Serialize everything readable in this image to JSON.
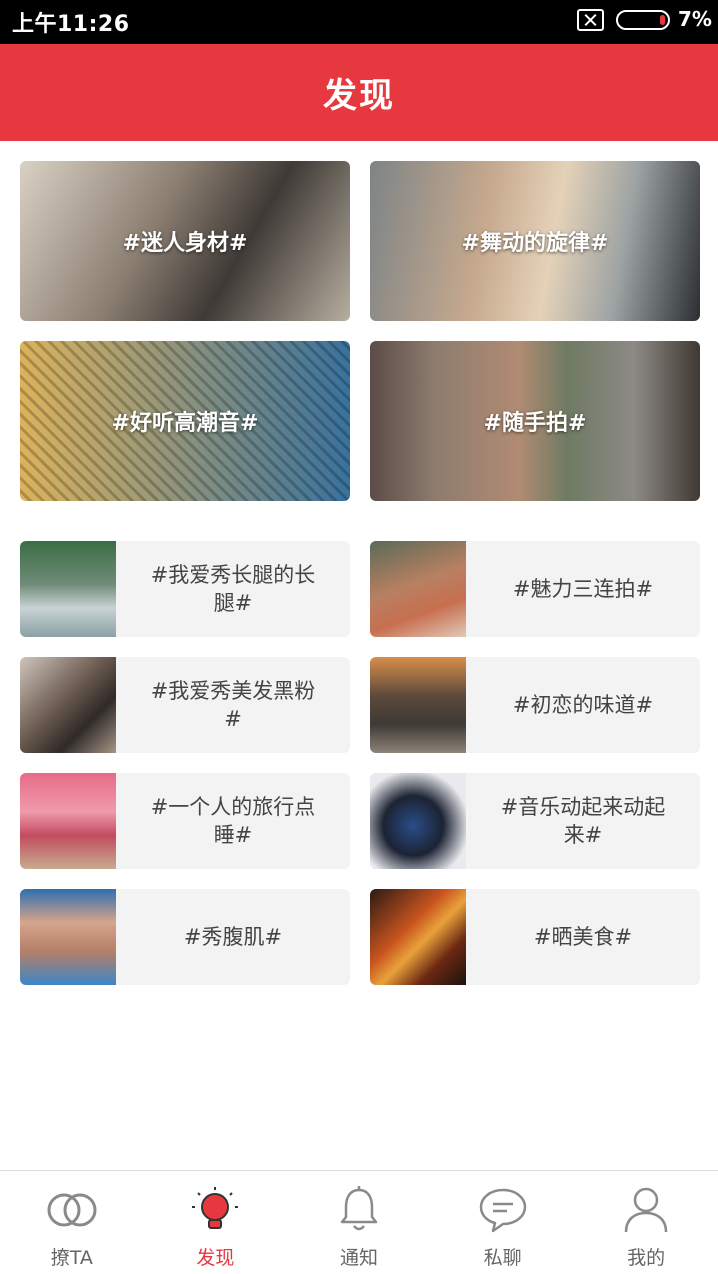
{
  "status_bar": {
    "time": "上午11:26",
    "battery": "7%"
  },
  "header": {
    "title": "发现"
  },
  "banners": [
    {
      "label": "#迷人身材#"
    },
    {
      "label": "#舞动的旋律#"
    },
    {
      "label": "#好听高潮音#"
    },
    {
      "label": "#随手拍#"
    }
  ],
  "topics": [
    {
      "label": "#我爱秀长腿的长腿#"
    },
    {
      "label": "#魅力三连拍#"
    },
    {
      "label": "#我爱秀美发黑粉#"
    },
    {
      "label": "#初恋的味道#"
    },
    {
      "label": "#一个人的旅行点睡#"
    },
    {
      "label": "#音乐动起来动起来#"
    },
    {
      "label": "#秀腹肌#"
    },
    {
      "label": "#晒美食#"
    }
  ],
  "tabs": [
    {
      "label": "撩TA",
      "icon": "rings-icon",
      "active": false
    },
    {
      "label": "发现",
      "icon": "lightbulb-icon",
      "active": true
    },
    {
      "label": "通知",
      "icon": "bell-icon",
      "active": false
    },
    {
      "label": "私聊",
      "icon": "chat-icon",
      "active": false
    },
    {
      "label": "我的",
      "icon": "person-icon",
      "active": false
    }
  ],
  "colors": {
    "accent": "#e8383f",
    "status_bar": "#000000",
    "card_bg": "#f3f3f3"
  }
}
